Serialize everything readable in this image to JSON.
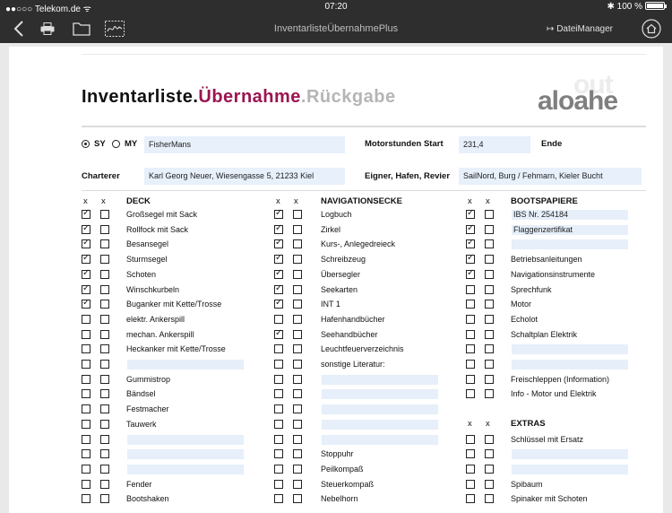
{
  "statusbar": {
    "carrier": "Telekom.de",
    "time": "07:20",
    "battery": "100 %"
  },
  "toolbar": {
    "title": "InventarlisteÜbernahmePlus",
    "dateimanager": "DateiManager",
    "dateimanager_icon": "↦"
  },
  "header": {
    "title_part1": "Inventarliste.",
    "title_part2": "Übernahme",
    "title_part3": ".Rückgabe",
    "logo_back": "out",
    "logo_front": "aloahe"
  },
  "form": {
    "radio_sy": "SY",
    "radio_my": "MY",
    "name_value": "FisherMans",
    "motorstunden_label": "Motorstunden Start",
    "motorstunden_value": "231,4",
    "ende_label": "Ende",
    "ende_value": "",
    "charterer_label": "Charterer",
    "charterer_value": "Karl Georg Neuer, Wiesengasse 5, 21233 Kiel",
    "eigner_label": "Eigner, Hafen, Revier",
    "eigner_value": "SailNord, Burg / Fehmarn, Kieler Bucht"
  },
  "columns": [
    {
      "x_labels": [
        "x",
        "x"
      ],
      "heading": "DECK",
      "rows": [
        {
          "text": "Großsegel mit Sack",
          "c1": true,
          "c2": false
        },
        {
          "text": "Rollfock mit Sack",
          "c1": true,
          "c2": false
        },
        {
          "text": "Besansegel",
          "c1": true,
          "c2": false
        },
        {
          "text": "Sturmsegel",
          "c1": true,
          "c2": false
        },
        {
          "text": "Schoten",
          "c1": true,
          "c2": false
        },
        {
          "text": "Winschkurbeln",
          "c1": true,
          "c2": false
        },
        {
          "text": "Buganker mit Kette/Trosse",
          "c1": true,
          "c2": false
        },
        {
          "text": "elektr. Ankerspill",
          "c1": false,
          "c2": false
        },
        {
          "text": "mechan. Ankerspill",
          "c1": false,
          "c2": false
        },
        {
          "text": "Heckanker mit Kette/Trosse",
          "c1": false,
          "c2": false
        },
        {
          "field": "",
          "c1": false,
          "c2": false
        },
        {
          "text": "Gummistrop",
          "c1": false,
          "c2": false
        },
        {
          "text": "Bändsel",
          "c1": false,
          "c2": false
        },
        {
          "text": "Festmacher",
          "c1": false,
          "c2": false
        },
        {
          "text": "Tauwerk",
          "c1": false,
          "c2": false
        },
        {
          "field": "",
          "c1": false,
          "c2": false
        },
        {
          "field": "",
          "c1": false,
          "c2": false
        },
        {
          "field": "",
          "c1": false,
          "c2": false
        },
        {
          "text": "Fender",
          "c1": false,
          "c2": false
        },
        {
          "text": "Bootshaken",
          "c1": false,
          "c2": false
        }
      ]
    },
    {
      "x_labels": [
        "x",
        "x"
      ],
      "heading": "NAVIGATIONSECKE",
      "rows": [
        {
          "text": "Logbuch",
          "c1": true,
          "c2": false
        },
        {
          "text": "Zirkel",
          "c1": true,
          "c2": false
        },
        {
          "text": "Kurs-, Anlegedreieck",
          "c1": true,
          "c2": false
        },
        {
          "text": "Schreibzeug",
          "c1": true,
          "c2": false
        },
        {
          "text": "Übersegler",
          "c1": true,
          "c2": false
        },
        {
          "text": "Seekarten",
          "c1": true,
          "c2": false
        },
        {
          "text": "INT 1",
          "c1": true,
          "c2": false
        },
        {
          "text": "Hafenhandbücher",
          "c1": false,
          "c2": false
        },
        {
          "text": "Seehandbücher",
          "c1": true,
          "c2": false
        },
        {
          "text": "Leuchtfeuerverzeichnis",
          "c1": false,
          "c2": false
        },
        {
          "text": "sonstige Literatur:",
          "c1": false,
          "c2": false
        },
        {
          "field": "",
          "c1": false,
          "c2": false
        },
        {
          "field": "",
          "c1": false,
          "c2": false
        },
        {
          "field": "",
          "c1": false,
          "c2": false
        },
        {
          "field": "",
          "c1": false,
          "c2": false
        },
        {
          "field": "",
          "c1": false,
          "c2": false
        },
        {
          "text": "Stoppuhr",
          "c1": false,
          "c2": false
        },
        {
          "text": "Peilkompaß",
          "c1": false,
          "c2": false
        },
        {
          "text": "Steuerkompaß",
          "c1": false,
          "c2": false
        },
        {
          "text": "Nebelhorn",
          "c1": false,
          "c2": false
        }
      ]
    },
    {
      "x_labels": [
        "x",
        "x"
      ],
      "heading": "BOOTSPAPIERE",
      "rows": [
        {
          "field": "IBS Nr. 254184",
          "c1": true,
          "c2": false
        },
        {
          "field": "Flaggenzertifikat",
          "c1": true,
          "c2": false
        },
        {
          "field": "",
          "c1": true,
          "c2": false
        },
        {
          "text": "Betriebsanleitungen",
          "c1": true,
          "c2": false
        },
        {
          "text": "Navigationsinstrumente",
          "c1": true,
          "c2": false
        },
        {
          "text": "Sprechfunk",
          "c1": false,
          "c2": false
        },
        {
          "text": "Motor",
          "c1": false,
          "c2": false
        },
        {
          "text": "Echolot",
          "c1": false,
          "c2": false
        },
        {
          "text": "Schaltplan Elektrik",
          "c1": false,
          "c2": false
        },
        {
          "field": "",
          "c1": false,
          "c2": false
        },
        {
          "field": "",
          "c1": false,
          "c2": false
        },
        {
          "text": "Freischleppen (Information)",
          "c1": false,
          "c2": false
        },
        {
          "text": "Info - Motor und Elektrik",
          "c1": false,
          "c2": false
        },
        {
          "spacer": true
        },
        {
          "header": true,
          "heading": "EXTRAS",
          "x_labels": [
            "x",
            "x"
          ]
        },
        {
          "text": "Schlüssel mit Ersatz",
          "c1": false,
          "c2": false
        },
        {
          "field": "",
          "c1": false,
          "c2": false
        },
        {
          "field": "",
          "c1": false,
          "c2": false
        },
        {
          "text": "Spibaum",
          "c1": false,
          "c2": false
        },
        {
          "text": "Spinaker mit Schoten",
          "c1": false,
          "c2": false
        }
      ]
    }
  ]
}
